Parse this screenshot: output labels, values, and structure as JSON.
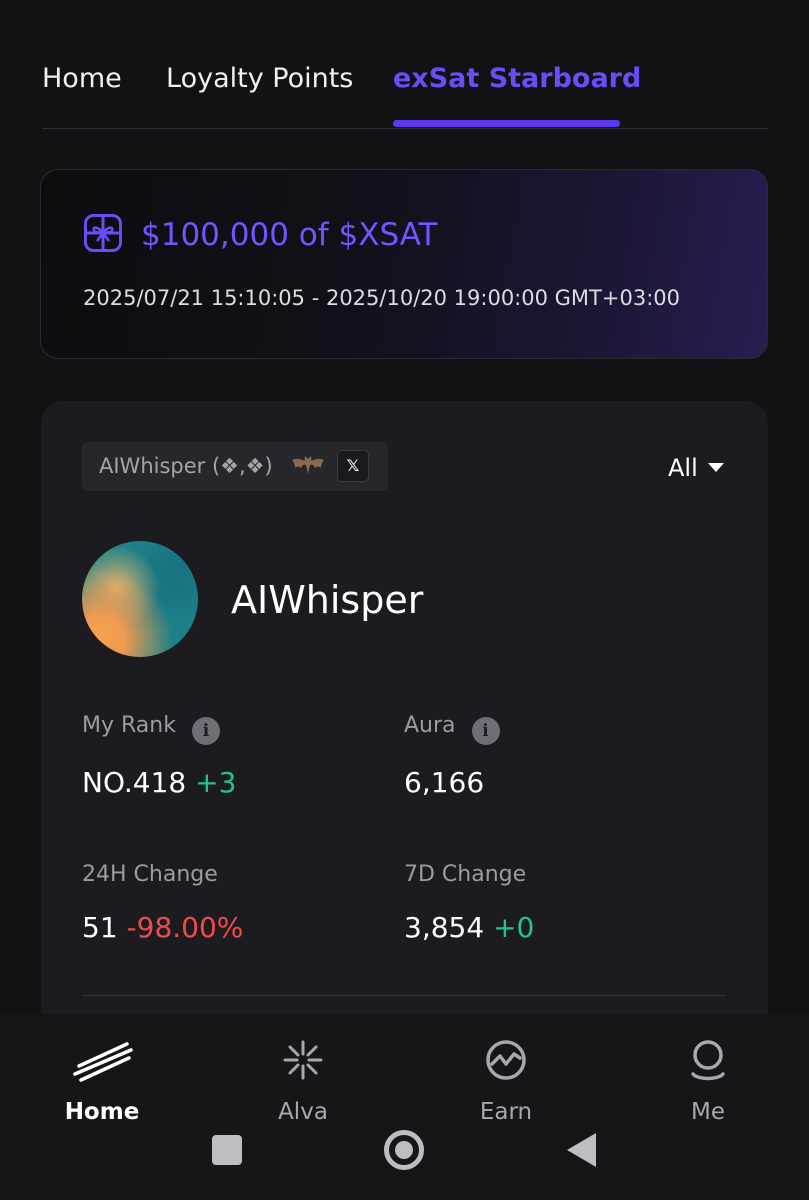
{
  "tabs": {
    "items": [
      {
        "label": "Home"
      },
      {
        "label": "Loyalty Points"
      },
      {
        "label": "exSat Starboard"
      }
    ],
    "active_index": 2,
    "accent_color": "#5b38ef"
  },
  "banner": {
    "icon": "gift-icon",
    "title": "$100,000 of $XSAT",
    "dates": "2025/07/21 15:10:05 - 2025/10/20 19:00:00 GMT+03:00"
  },
  "profile": {
    "chip_name": "AIWhisper (❖,❖)",
    "chip_emoji_icon": "bat-icon",
    "chip_social_icon": "x-logo-icon",
    "chip_social_label": "𝕏",
    "filter_label": "All",
    "username": "AIWhisper"
  },
  "stats": {
    "rank": {
      "label": "My Rank",
      "value": "NO.418",
      "delta": "+3"
    },
    "aura": {
      "label": "Aura",
      "value": "6,166"
    },
    "change_24h": {
      "label": "24H Change",
      "value": "51",
      "delta": "-98.00%"
    },
    "change_7d": {
      "label": "7D Change",
      "value": "3,854",
      "delta": "+0"
    }
  },
  "bottom_nav": {
    "items": [
      {
        "label": "Home",
        "icon": "home-streaks-icon"
      },
      {
        "label": "Alva",
        "icon": "alva-star-icon"
      },
      {
        "label": "Earn",
        "icon": "earn-chart-icon"
      },
      {
        "label": "Me",
        "icon": "user-icon"
      }
    ],
    "active_index": 0
  },
  "colors": {
    "positive": "#23c48a",
    "negative": "#ef4b4b",
    "accent_text": "#6f56ff"
  }
}
